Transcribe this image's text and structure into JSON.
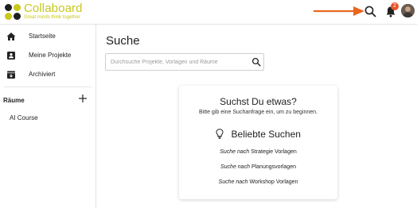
{
  "header": {
    "brand_name": "Collaboard",
    "brand_tagline": "Great minds think together",
    "notification_count": "2",
    "colors": {
      "brand": "#c7c81a",
      "logo_dark": "#1f1f1f",
      "arrow": "#e8661e",
      "badge": "#e8542a"
    },
    "icons": [
      "collaboard-logo-icon",
      "arrow-right-icon",
      "search-icon",
      "bell-icon",
      "avatar"
    ]
  },
  "sidebar": {
    "items": [
      {
        "label": "Startseite",
        "icon": "home-icon"
      },
      {
        "label": "Meine Projekte",
        "icon": "user-board-icon"
      },
      {
        "label": "Archiviert",
        "icon": "archive-icon"
      }
    ],
    "rooms_title": "Räume",
    "rooms": [
      {
        "label": "AI Course"
      }
    ]
  },
  "main": {
    "title": "Suche",
    "search_placeholder": "Durchsuche Projekte, Vorlagen und Räume",
    "card": {
      "title": "Suchst Du etwas?",
      "subtitle": "Bitte gib eine Suchanfrage ein, um zu beginnen.",
      "popular_title": "Beliebte Suchen",
      "suggestion_prefix": "Suche nach",
      "suggestions": [
        {
          "prefix": "Suche nach",
          "term": "Strategie Vorlagen"
        },
        {
          "prefix": "Suche nach",
          "term": "Planungsvorlagen"
        },
        {
          "prefix": "Suche nach",
          "term": "Workshop Vorlagen"
        }
      ]
    }
  }
}
